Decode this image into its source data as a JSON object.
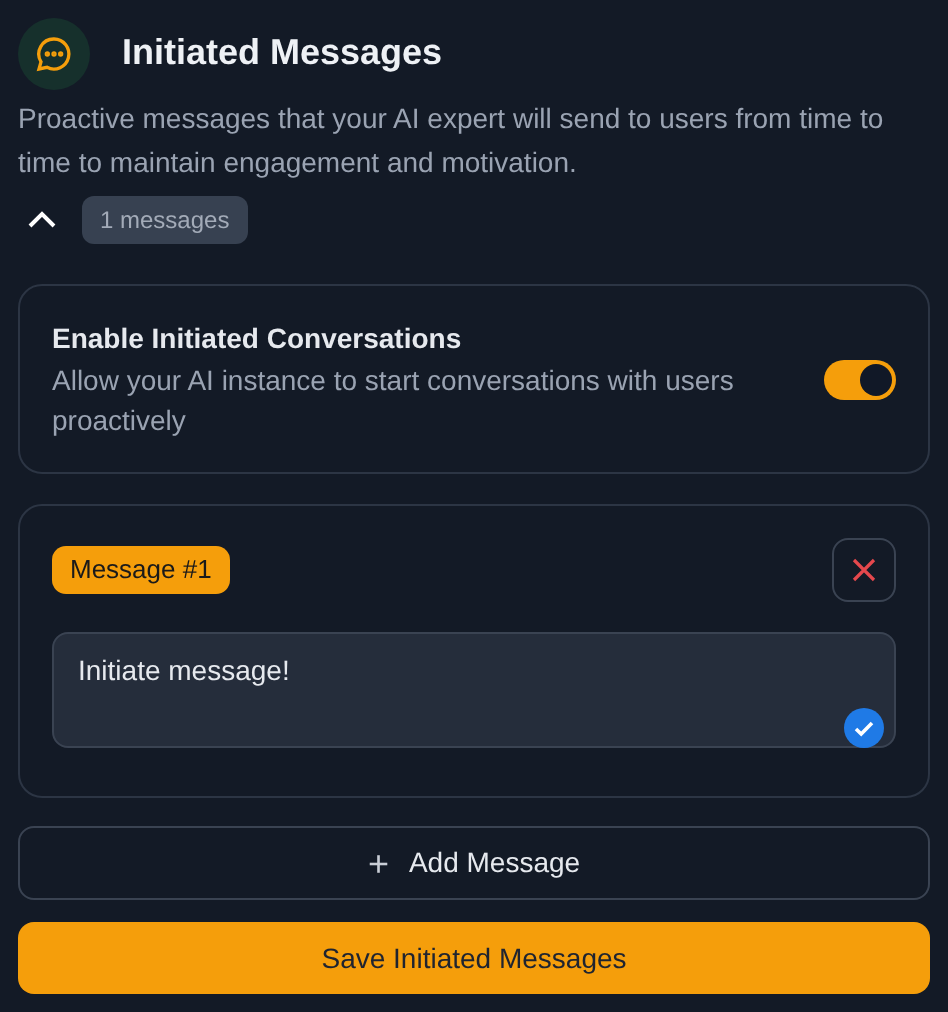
{
  "header": {
    "title": "Initiated Messages",
    "description": "Proactive messages that your AI expert will send to users from time to time to maintain engagement and motivation."
  },
  "section": {
    "expanded": true,
    "count_badge": "1 messages"
  },
  "setting": {
    "title": "Enable Initiated Conversations",
    "description": "Allow your AI instance to start conversations with users proactively",
    "on": true
  },
  "messages": [
    {
      "label": "Message #1",
      "value": "Initiate message!",
      "validated": true
    }
  ],
  "add_button": "+",
  "add_label": "Add Message",
  "save_button": "Save Initiated Messages"
}
